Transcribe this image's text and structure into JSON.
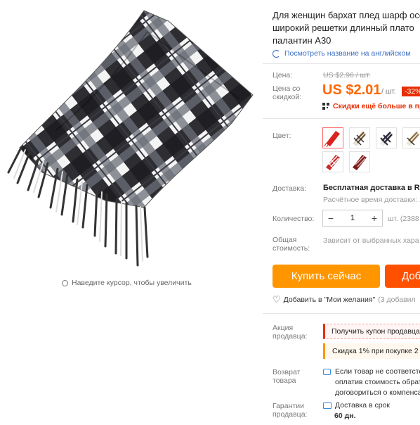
{
  "product": {
    "title_lines": [
      "Для женщин бархат плед шарф осе",
      "широкий решетки длинный плато",
      "палантин A30"
    ],
    "translate_link": "Посмотреть название на английском"
  },
  "image": {
    "zoom_hint": "Наведите курсор, чтобы увеличить"
  },
  "price": {
    "label": "Цена:",
    "original": "US $2.96 / шт.",
    "discount_label_lines": [
      "Цена со",
      "скидкой:"
    ],
    "discounted": "US $2.01",
    "unit": "/ шт.",
    "discount_badge": "-32%",
    "more_discounts": "Скидки ещё больше в при"
  },
  "color": {
    "label": "Цвет:",
    "options": [
      {
        "name": "red",
        "color": "#d9231f",
        "selected": true
      },
      {
        "name": "brown-plaid",
        "color": "#6a4a2e",
        "selected": false
      },
      {
        "name": "black-plaid",
        "color": "#2b2b3a",
        "selected": false
      },
      {
        "name": "tan-plaid",
        "color": "#8a6a44",
        "selected": false
      },
      {
        "name": "red-plaid",
        "color": "#c92a2a",
        "selected": false
      },
      {
        "name": "dark-red-plaid",
        "color": "#7a1a1a",
        "selected": false
      }
    ]
  },
  "shipping": {
    "label": "Доставка:",
    "value": "Бесплатная доставка в Rus",
    "estimate": "Расчётное время доставки: 1"
  },
  "quantity": {
    "label": "Количество:",
    "minus": "−",
    "value": "1",
    "plus": "+",
    "stock": "шт. (2388"
  },
  "total": {
    "label_lines": [
      "Общая",
      "стоимость:"
    ],
    "value": "Зависит от выбранных хара"
  },
  "actions": {
    "buy_now": "Купить сейчас",
    "add_to_cart": "Доба",
    "wishlist": "Добавить в \"Мои желания\"",
    "wishlist_count": "(3 добавил"
  },
  "promotion": {
    "label_lines": [
      "Акция",
      "продавца:"
    ],
    "coupon": "Получить купон продавца",
    "discount": "Скидка 1% при покупке 2 н"
  },
  "return": {
    "label_lines": [
      "Возврат",
      "товара"
    ],
    "lines": [
      "Если товар не соответсте",
      "оплатив стоимость обрат",
      "договориться о компенса"
    ]
  },
  "guarantee": {
    "label_lines": [
      "Гарантии",
      "продавца:"
    ],
    "delivery": "Доставка в срок",
    "days": "60 дн."
  },
  "colors": {
    "accent": "#f60",
    "price": "#f60",
    "badge": "#e62e04",
    "buy": "#ff9600",
    "cart": "#ff5000",
    "link": "#3a6dc4"
  }
}
